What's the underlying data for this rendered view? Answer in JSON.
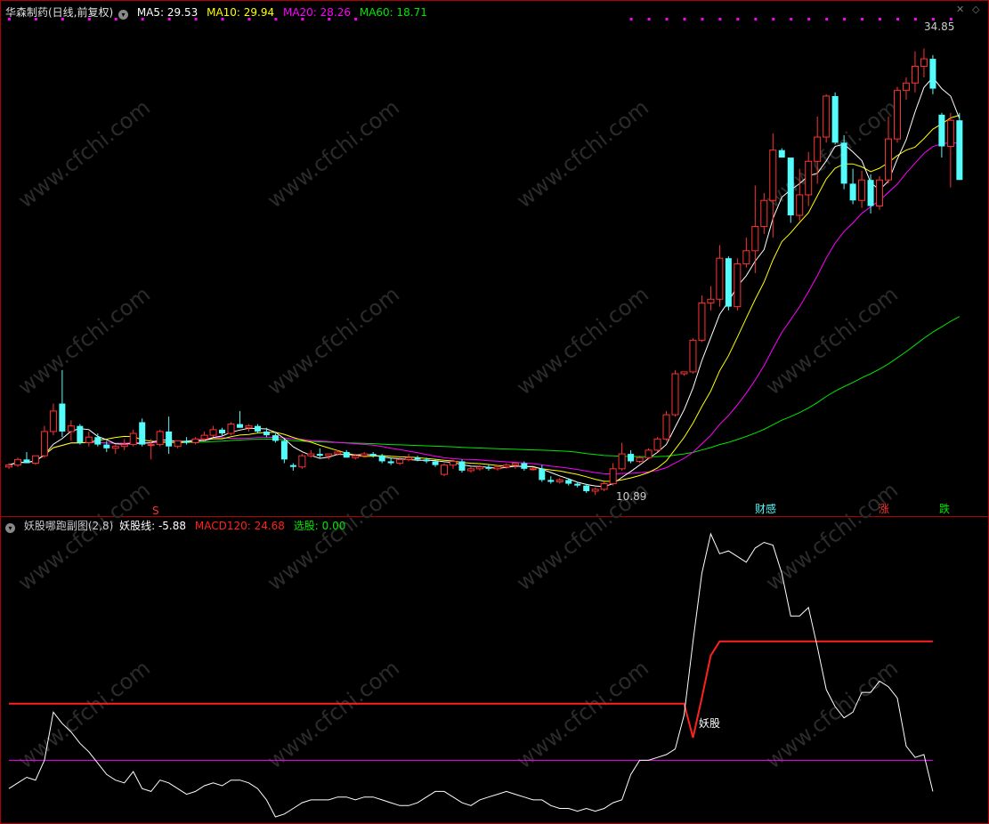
{
  "main_header": {
    "title": "华森制药(日线,前复权)",
    "ma5": "MA5: 29.53",
    "ma10": "MA10: 29.94",
    "ma20": "MA20: 28.26",
    "ma60": "MA60: 18.71"
  },
  "sub_header": {
    "title": "妖股哪跑副图(2,8)",
    "line1": "妖股线: -5.88",
    "line2": "MACD120: 24.68",
    "line3": "选股: 0.00"
  },
  "annotations": {
    "high_label": "34.85",
    "low_label": "10.89",
    "marker_s": "S",
    "marker_finance": "财感",
    "marker_up": "涨",
    "marker_down": "跌",
    "yaogu_label": "妖股"
  },
  "watermark": "www.cfchi.com",
  "colors": {
    "up": "#ff3232",
    "down": "#54fcfc",
    "ma5": "#ffffff",
    "ma10": "#ffff00",
    "ma20": "#ff00ff",
    "ma60": "#00e600",
    "border": "#b00000",
    "sub_white": "#ffffff",
    "sub_red": "#ff2020",
    "sub_magenta": "#ff00ff",
    "dots": "#ff00ff"
  },
  "chart_data": [
    {
      "type": "candlestick",
      "title": "华森制药(日线,前复权)",
      "price_range": [
        10.0,
        36.5
      ],
      "high": 34.85,
      "low": 10.89,
      "candles": [
        [
          12.4,
          12.6,
          12.3,
          12.5
        ],
        [
          12.5,
          12.9,
          12.4,
          12.8
        ],
        [
          12.8,
          13.2,
          12.7,
          12.6
        ],
        [
          12.6,
          13.0,
          12.5,
          13.0
        ],
        [
          13.0,
          14.6,
          12.9,
          14.3
        ],
        [
          14.3,
          15.8,
          14.1,
          15.4
        ],
        [
          15.8,
          17.6,
          14.0,
          14.3
        ],
        [
          14.3,
          14.9,
          13.8,
          14.6
        ],
        [
          14.6,
          14.7,
          13.6,
          13.7
        ],
        [
          13.7,
          14.3,
          13.5,
          14.0
        ],
        [
          14.0,
          14.2,
          13.5,
          13.6
        ],
        [
          13.6,
          13.8,
          13.2,
          13.4
        ],
        [
          13.4,
          13.6,
          13.1,
          13.5
        ],
        [
          13.5,
          13.9,
          13.3,
          13.6
        ],
        [
          13.6,
          14.4,
          13.5,
          14.2
        ],
        [
          14.8,
          15.0,
          13.5,
          13.6
        ],
        [
          13.6,
          13.9,
          12.8,
          13.6
        ],
        [
          13.6,
          14.4,
          13.5,
          14.3
        ],
        [
          14.3,
          15.1,
          13.1,
          13.5
        ],
        [
          13.5,
          13.8,
          13.4,
          13.8
        ],
        [
          13.8,
          14.0,
          13.6,
          13.7
        ],
        [
          13.7,
          14.0,
          13.6,
          13.9
        ],
        [
          13.9,
          14.3,
          13.8,
          14.1
        ],
        [
          14.1,
          14.6,
          14.0,
          14.4
        ],
        [
          14.4,
          14.5,
          14.1,
          14.2
        ],
        [
          14.2,
          14.8,
          14.1,
          14.7
        ],
        [
          14.7,
          15.4,
          14.5,
          14.5
        ],
        [
          14.5,
          14.7,
          14.3,
          14.6
        ],
        [
          14.6,
          14.7,
          14.2,
          14.3
        ],
        [
          14.3,
          14.5,
          14.0,
          14.1
        ],
        [
          14.1,
          14.2,
          13.7,
          13.8
        ],
        [
          13.8,
          13.9,
          12.6,
          12.8
        ],
        [
          12.5,
          12.6,
          12.2,
          12.4
        ],
        [
          12.4,
          13.1,
          12.3,
          13.0
        ],
        [
          13.0,
          13.3,
          12.9,
          13.1
        ],
        [
          13.1,
          13.4,
          12.9,
          13.0
        ],
        [
          13.0,
          13.1,
          12.8,
          13.1
        ],
        [
          13.1,
          13.3,
          13.0,
          13.2
        ],
        [
          13.2,
          13.3,
          12.9,
          12.9
        ],
        [
          12.9,
          13.1,
          12.8,
          13.0
        ],
        [
          13.0,
          13.2,
          12.9,
          13.1
        ],
        [
          13.1,
          13.2,
          12.9,
          13.0
        ],
        [
          13.0,
          13.1,
          12.6,
          12.7
        ],
        [
          12.7,
          12.9,
          12.5,
          12.6
        ],
        [
          12.6,
          12.9,
          12.5,
          12.8
        ],
        [
          12.8,
          13.1,
          12.7,
          12.9
        ],
        [
          12.9,
          13.0,
          12.7,
          12.8
        ],
        [
          12.8,
          12.9,
          12.6,
          12.7
        ],
        [
          12.7,
          12.8,
          12.4,
          12.5
        ],
        [
          12.0,
          12.6,
          11.9,
          12.5
        ],
        [
          12.5,
          12.8,
          12.3,
          12.7
        ],
        [
          12.7,
          12.8,
          12.1,
          12.2
        ],
        [
          12.2,
          12.4,
          12.1,
          12.3
        ],
        [
          12.3,
          12.5,
          12.2,
          12.4
        ],
        [
          12.4,
          12.5,
          12.2,
          12.3
        ],
        [
          12.3,
          12.5,
          12.2,
          12.4
        ],
        [
          12.4,
          12.6,
          12.3,
          12.5
        ],
        [
          12.5,
          12.6,
          12.3,
          12.6
        ],
        [
          12.6,
          12.7,
          12.2,
          12.3
        ],
        [
          12.3,
          12.4,
          12.2,
          12.3
        ],
        [
          12.3,
          12.5,
          11.6,
          11.7
        ],
        [
          11.7,
          11.9,
          11.5,
          11.6
        ],
        [
          11.6,
          11.8,
          11.5,
          11.7
        ],
        [
          11.7,
          11.8,
          11.4,
          11.5
        ],
        [
          11.5,
          11.6,
          11.3,
          11.4
        ],
        [
          11.4,
          11.5,
          11.0,
          11.1
        ],
        [
          11.1,
          11.3,
          10.89,
          11.2
        ],
        [
          11.2,
          11.6,
          11.1,
          11.5
        ],
        [
          11.5,
          12.6,
          11.4,
          12.3
        ],
        [
          12.3,
          13.7,
          12.2,
          13.1
        ],
        [
          13.1,
          13.3,
          12.6,
          12.7
        ],
        [
          12.7,
          13.0,
          12.6,
          12.9
        ],
        [
          12.9,
          13.4,
          12.8,
          13.3
        ],
        [
          13.3,
          14.0,
          13.2,
          13.9
        ],
        [
          13.9,
          15.4,
          13.8,
          15.2
        ],
        [
          15.2,
          17.6,
          15.1,
          17.4
        ],
        [
          17.4,
          17.5,
          17.3,
          17.5
        ],
        [
          17.5,
          19.3,
          17.4,
          19.2
        ],
        [
          19.2,
          21.6,
          19.1,
          21.2
        ],
        [
          21.2,
          22.1,
          20.8,
          21.4
        ],
        [
          21.4,
          24.3,
          21.0,
          23.6
        ],
        [
          23.6,
          23.7,
          20.8,
          21.0
        ],
        [
          21.0,
          23.6,
          20.8,
          23.3
        ],
        [
          23.3,
          24.7,
          23.1,
          24.0
        ],
        [
          24.0,
          27.5,
          22.8,
          25.3
        ],
        [
          25.3,
          27.1,
          24.9,
          26.7
        ],
        [
          26.7,
          30.3,
          24.7,
          29.4
        ],
        [
          29.4,
          29.5,
          29.0,
          29.0
        ],
        [
          29.0,
          28.9,
          25.5,
          25.9
        ],
        [
          25.9,
          28.4,
          25.6,
          27.0
        ],
        [
          27.0,
          29.3,
          26.4,
          28.8
        ],
        [
          28.8,
          31.2,
          27.6,
          30.1
        ],
        [
          30.1,
          32.4,
          29.8,
          32.3
        ],
        [
          32.3,
          32.5,
          29.7,
          29.8
        ],
        [
          29.8,
          30.2,
          27.3,
          27.6
        ],
        [
          27.6,
          28.4,
          26.5,
          26.7
        ],
        [
          26.7,
          28.3,
          26.3,
          27.8
        ],
        [
          27.8,
          28.1,
          26.0,
          26.4
        ],
        [
          26.4,
          28.0,
          26.2,
          27.8
        ],
        [
          27.8,
          31.2,
          27.6,
          30.0
        ],
        [
          30.0,
          32.8,
          29.8,
          32.6
        ],
        [
          32.6,
          33.3,
          32.1,
          33.0
        ],
        [
          33.0,
          34.7,
          32.5,
          33.9
        ],
        [
          33.9,
          34.85,
          33.3,
          34.3
        ],
        [
          34.3,
          34.5,
          32.4,
          32.7
        ],
        [
          31.3,
          31.4,
          29.0,
          29.6
        ],
        [
          29.6,
          31.4,
          27.4,
          31.0
        ],
        [
          31.0,
          31.4,
          27.8,
          27.8
        ]
      ],
      "ma_series": [
        {
          "name": "MA5",
          "value": 29.53
        },
        {
          "name": "MA10",
          "value": 29.94
        },
        {
          "name": "MA20",
          "value": 28.26
        },
        {
          "name": "MA60",
          "value": 18.71
        }
      ],
      "signal_markers": [
        "S",
        "财感",
        "涨",
        "跌"
      ]
    },
    {
      "type": "line",
      "title": "妖股哪跑副图(2,8)",
      "y_range": [
        0,
        100
      ],
      "series": [
        {
          "name": "妖股线",
          "values": [
            10,
            12,
            14,
            13,
            20,
            37,
            33,
            30,
            26,
            23,
            19,
            15,
            13,
            12,
            16,
            10,
            9,
            13,
            12,
            10,
            8,
            9,
            11,
            12,
            11,
            13,
            13,
            12,
            10,
            6,
            0,
            1,
            3,
            5,
            6,
            6,
            6,
            7,
            7,
            6,
            7,
            7,
            6,
            5,
            4,
            4,
            5,
            7,
            9,
            9,
            7,
            5,
            4,
            6,
            7,
            8,
            9,
            8,
            7,
            6,
            6,
            4,
            3,
            3,
            2,
            3,
            2,
            3,
            5,
            6,
            15,
            20,
            20,
            21,
            22,
            24,
            36,
            62,
            86,
            100,
            93,
            94,
            92,
            90,
            95,
            97,
            96,
            86,
            71,
            71,
            74,
            60,
            45,
            39,
            35,
            37,
            44,
            44,
            48,
            46,
            42,
            25,
            21,
            22,
            9
          ]
        },
        {
          "name": "MACD120",
          "values": [
            40,
            40,
            40,
            40,
            40,
            40,
            40,
            40,
            40,
            40,
            40,
            40,
            40,
            40,
            40,
            40,
            40,
            40,
            40,
            40,
            40,
            40,
            40,
            40,
            40,
            40,
            40,
            40,
            40,
            40,
            40,
            40,
            40,
            40,
            40,
            40,
            40,
            40,
            40,
            40,
            40,
            40,
            40,
            40,
            40,
            40,
            40,
            40,
            40,
            40,
            40,
            40,
            40,
            40,
            40,
            40,
            40,
            40,
            40,
            40,
            40,
            40,
            40,
            40,
            40,
            40,
            40,
            40,
            40,
            40,
            40,
            40,
            40,
            40,
            40,
            40,
            40,
            28,
            42,
            57,
            62,
            62,
            62,
            62,
            62,
            62,
            62,
            62,
            62,
            62,
            62,
            62,
            62,
            62,
            62,
            62,
            62,
            62,
            62,
            62,
            62,
            62,
            62,
            62,
            62
          ]
        },
        {
          "name": "选股",
          "values": [
            20,
            20,
            20,
            20,
            20,
            20,
            20,
            20,
            20,
            20,
            20,
            20,
            20,
            20,
            20,
            20,
            20,
            20,
            20,
            20,
            20,
            20,
            20,
            20,
            20,
            20,
            20,
            20,
            20,
            20,
            20,
            20,
            20,
            20,
            20,
            20,
            20,
            20,
            20,
            20,
            20,
            20,
            20,
            20,
            20,
            20,
            20,
            20,
            20,
            20,
            20,
            20,
            20,
            20,
            20,
            20,
            20,
            20,
            20,
            20,
            20,
            20,
            20,
            20,
            20,
            20,
            20,
            20,
            20,
            20,
            20,
            20,
            20,
            20,
            20,
            20,
            20,
            20,
            20,
            20,
            20,
            20,
            20,
            20,
            20,
            20,
            20,
            20,
            20,
            20,
            20,
            20,
            20,
            20,
            20,
            20,
            20,
            20,
            20,
            20,
            20,
            20,
            20,
            20,
            20
          ]
        }
      ],
      "annotation": "妖股"
    }
  ]
}
